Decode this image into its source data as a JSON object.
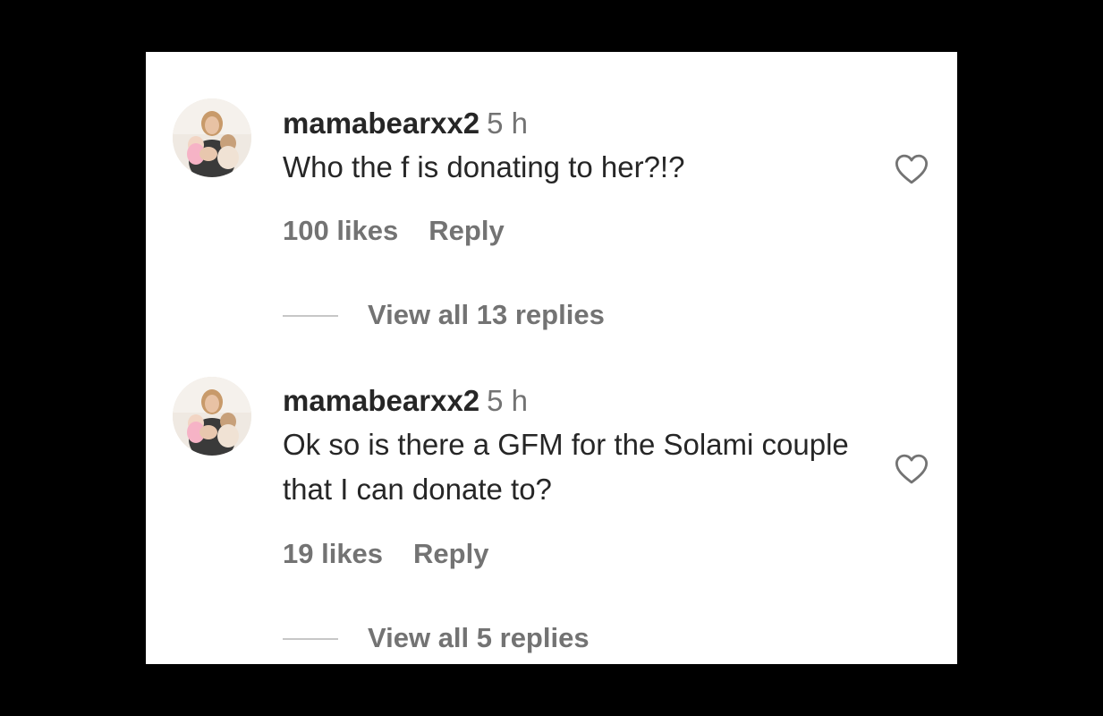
{
  "colors": {
    "background": "#000000",
    "panel": "#ffffff",
    "text_primary": "#262626",
    "text_secondary": "#737373",
    "divider": "#c7c7c7"
  },
  "comments": [
    {
      "username": "mamabearxx2",
      "time": "5 h",
      "text": "Who the f is donating to her?!?",
      "likes": "100 likes",
      "reply_label": "Reply",
      "view_replies": "View all 13 replies",
      "like_icon": "heart-outline-icon",
      "avatar_icon": "profile-photo"
    },
    {
      "username": "mamabearxx2",
      "time": "5 h",
      "text": "Ok so is there a GFM for the Solami couple that I can donate to?",
      "likes": "19 likes",
      "reply_label": "Reply",
      "view_replies": "View all 5 replies",
      "like_icon": "heart-outline-icon",
      "avatar_icon": "profile-photo"
    }
  ]
}
